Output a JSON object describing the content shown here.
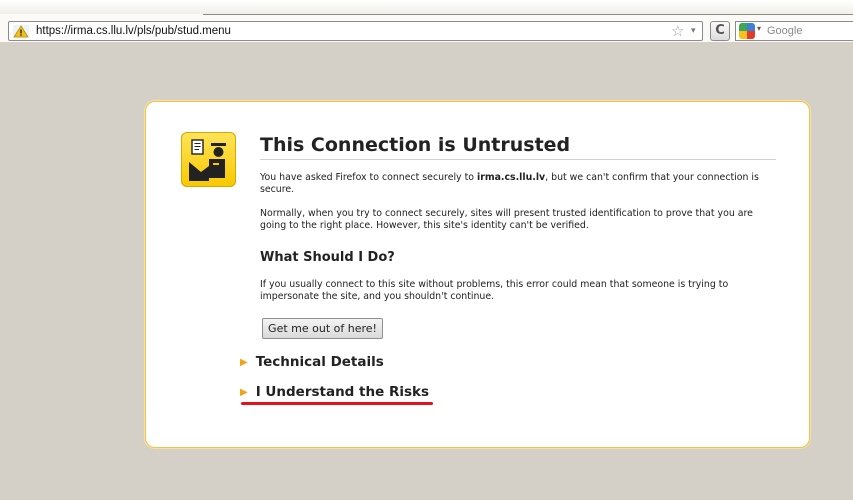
{
  "browser": {
    "url": "https://irma.cs.llu.lv/pls/pub/stud.menu",
    "search_placeholder": "Google",
    "reload_glyph": "C"
  },
  "error_page": {
    "title": "This Connection is Untrusted",
    "intro_prefix": "You have asked Firefox to connect securely to ",
    "host": "irma.cs.llu.lv",
    "intro_suffix": ", but we can't confirm that your connection is secure.",
    "explanation": "Normally, when you try to connect securely, sites will present trusted identification to prove that you are going to the right place. However, this site's identity can't be verified.",
    "what_heading": "What Should I Do?",
    "advice": "If you usually connect to this site without problems, this error could mean that someone is trying to impersonate the site, and you shouldn't continue.",
    "escape_button": "Get me out of here!",
    "technical_details": "Technical Details",
    "understand_risks": "I Understand the Risks"
  },
  "colors": {
    "warning_yellow": "#f8c800",
    "box_border": "#edc24e",
    "annotation_red": "#e2131a"
  }
}
